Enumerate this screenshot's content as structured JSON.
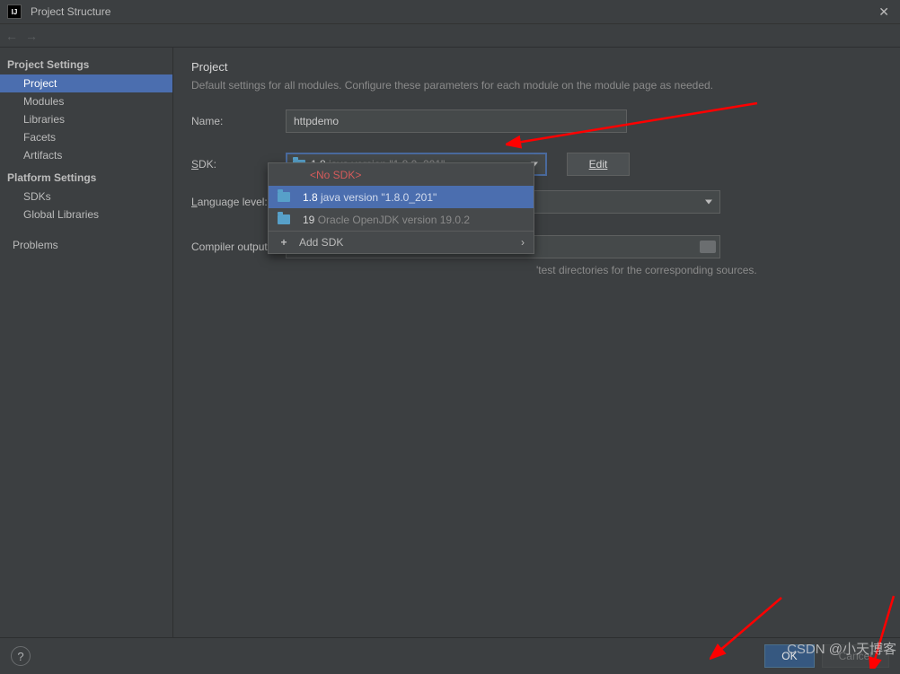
{
  "titlebar": {
    "title": "Project Structure"
  },
  "sidebar": {
    "heading_project": "Project Settings",
    "items_project": [
      "Project",
      "Modules",
      "Libraries",
      "Facets",
      "Artifacts"
    ],
    "heading_platform": "Platform Settings",
    "items_platform": [
      "SDKs",
      "Global Libraries"
    ],
    "problems": "Problems"
  },
  "content": {
    "section_title": "Project",
    "section_desc": "Default settings for all modules. Configure these parameters for each module on the module page as needed.",
    "name_label": "Name:",
    "name_value": "httpdemo",
    "sdk_label_prefix": "S",
    "sdk_label_suffix": "DK:",
    "sdk_value_main": "1.8 ",
    "sdk_value_sub": "java version \"1.8.0_201\"",
    "edit_btn": "Edit",
    "lang_label_prefix": "L",
    "lang_label_suffix": "anguage level:",
    "compiler_label": "Compiler output:",
    "hint_tail": "'test directories for the corresponding sources."
  },
  "dropdown": {
    "no_sdk": "<No SDK>",
    "opt1_main": "1.8 ",
    "opt1_sub": "java version \"1.8.0_201\"",
    "opt2_main": "19 ",
    "opt2_sub": "Oracle OpenJDK version 19.0.2",
    "add": "Add SDK"
  },
  "footer": {
    "ok": "OK",
    "cancel": "Cancel"
  },
  "watermark": "CSDN @小天博客"
}
